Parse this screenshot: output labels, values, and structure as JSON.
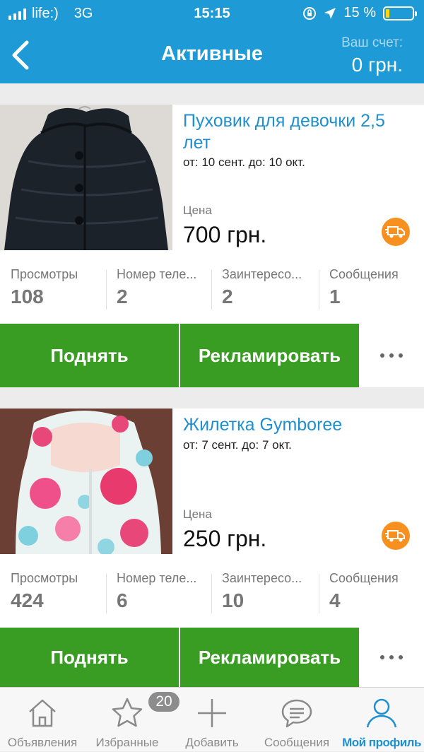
{
  "status_bar": {
    "carrier": "life:)",
    "network": "3G",
    "time": "15:15",
    "battery": "15 %",
    "battery_level": 0.15
  },
  "header": {
    "back_icon": "chevron-left-icon",
    "title": "Активные",
    "account_label": "Ваш счет:",
    "account_value": "0 грн."
  },
  "listings": [
    {
      "title": "Пуховик для девочки 2,5 лет",
      "dates": "от: 10 сент. до: 10 окт.",
      "price_label": "Цена",
      "price": "700 грн.",
      "photo": "black-puffer-jacket",
      "delivery_icon": "delivery-truck-icon",
      "stats": [
        {
          "label": "Просмотры",
          "value": "108"
        },
        {
          "label": "Номер теле...",
          "value": "2"
        },
        {
          "label": "Заинтересо...",
          "value": "2"
        },
        {
          "label": "Сообщения",
          "value": "1"
        }
      ],
      "raise_label": "Поднять",
      "promote_label": "Рекламировать",
      "more_icon": "more-dots-icon"
    },
    {
      "title": "Жилетка Gymboree",
      "dates": "от: 7 сент. до: 7 окт.",
      "price_label": "Цена",
      "price": "250 грн.",
      "photo": "floral-vest",
      "delivery_icon": "delivery-truck-icon",
      "stats": [
        {
          "label": "Просмотры",
          "value": "424"
        },
        {
          "label": "Номер теле...",
          "value": "6"
        },
        {
          "label": "Заинтересо...",
          "value": "10"
        },
        {
          "label": "Сообщения",
          "value": "4"
        }
      ],
      "raise_label": "Поднять",
      "promote_label": "Рекламировать",
      "more_icon": "more-dots-icon"
    }
  ],
  "tab_bar": {
    "tabs": [
      {
        "label": "Объявления",
        "icon": "home-icon",
        "active": false
      },
      {
        "label": "Избранные",
        "icon": "star-icon",
        "active": false,
        "badge": "20"
      },
      {
        "label": "Добавить",
        "icon": "plus-icon",
        "active": false
      },
      {
        "label": "Сообщения",
        "icon": "chat-bubble-icon",
        "active": false
      },
      {
        "label": "Мой профиль",
        "icon": "user-icon",
        "active": true
      }
    ]
  },
  "colors": {
    "brand_blue": "#1e9bd7",
    "button_green": "#3a9d23",
    "delivery_orange": "#f7901e",
    "link_blue": "#1f8fd0"
  }
}
